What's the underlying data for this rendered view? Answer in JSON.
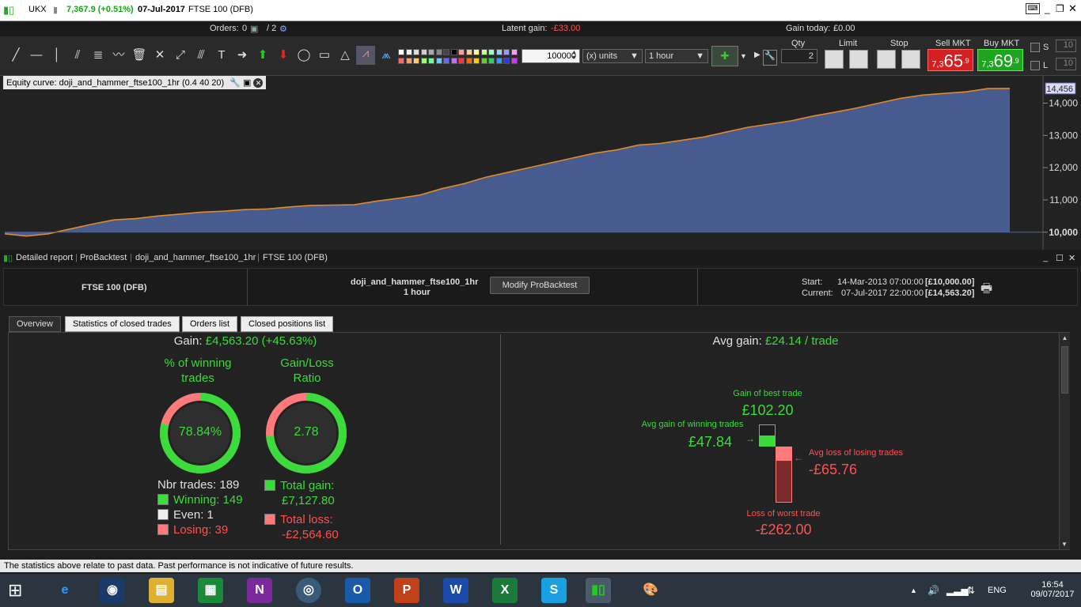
{
  "titlebar": {
    "symbol": "UKX",
    "price": "7,367.9 (+0.51%)",
    "date": "07-Jul-2017",
    "instrument": "FTSE 100 (DFB)"
  },
  "infobar": {
    "orders_label": "Orders:",
    "orders_count": "0",
    "orders_count2": "/ 2",
    "latent_label": "Latent gain:",
    "latent_value": "-£33.00",
    "gain_today_label": "Gain today:",
    "gain_today_value": "£0.00"
  },
  "toolbar": {
    "quantity_value": "100000",
    "units_option": "(x) units",
    "timeframe_option": "1 hour",
    "qty_header": "Qty",
    "qty_value": "2",
    "limit_header": "Limit",
    "stop_header": "Stop",
    "sell_header": "Sell MKT",
    "buy_header": "Buy MKT",
    "sell_prefix": "7,3",
    "sell_big": "65",
    "sell_sup": ".9",
    "buy_prefix": "7,3",
    "buy_big": "69",
    "buy_sup": ".9",
    "s_label": "S",
    "l_label": "L",
    "s_value": "10",
    "l_value": "10"
  },
  "chart": {
    "title": "Equity curve: doji_and_hammer_ftse100_1hr (0.4 40 20)",
    "current_value_label": "14,456",
    "yticks": [
      "14,000",
      "13,000",
      "12,000",
      "11,000",
      "10,000"
    ]
  },
  "chart_data": {
    "type": "area",
    "title": "Equity curve: doji_and_hammer_ftse100_1hr (0.4 40 20)",
    "xlabel": "",
    "ylabel": "",
    "ylim": [
      9700,
      14600
    ],
    "baseline": 10000,
    "series": [
      {
        "values": [
          9950,
          9880,
          9950,
          10100,
          10250,
          10380,
          10420,
          10500,
          10560,
          10620,
          10650,
          10700,
          10720,
          10780,
          10830,
          10840,
          10850,
          10960,
          11050,
          11150,
          11350,
          11500,
          11700,
          11850,
          12000,
          12150,
          12300,
          12450,
          12550,
          12700,
          12750,
          12850,
          12950,
          13100,
          13250,
          13350,
          13450,
          13600,
          13720,
          13850,
          14000,
          14150,
          14250,
          14300,
          14350,
          14450,
          14456
        ]
      }
    ]
  },
  "report": {
    "panel_label": "Detailed report",
    "crumb1": "ProBacktest",
    "crumb2": "doji_and_hammer_ftse100_1hr",
    "crumb3": "FTSE 100 (DFB)",
    "instrument": "FTSE 100 (DFB)",
    "strategy": "doji_and_hammer_ftse100_1hr",
    "timeframe": "1 hour",
    "modify_button": "Modify ProBacktest",
    "start_label": "Start:",
    "start_date": "14-Mar-2013 07:00:00",
    "start_value": "[£10,000.00]",
    "current_label": "Current:",
    "current_date": "07-Jul-2017 22:00:00",
    "current_value": "[£14,563.20]"
  },
  "tabs": [
    "Overview",
    "Statistics of closed trades",
    "Orders list",
    "Closed positions list"
  ],
  "overview": {
    "gain_label": "Gain:",
    "gain_value": "£4,563.20 (+45.63%)",
    "win_title1": "% of winning",
    "win_title2": "trades",
    "win_pct": "78.84%",
    "win_fraction": 0.7884,
    "ratio_title1": "Gain/Loss",
    "ratio_title2": "Ratio",
    "ratio_value": "2.78",
    "ratio_fraction": 0.7355,
    "nbr_trades": "Nbr trades: 189",
    "winning": "Winning: 149",
    "even": "Even: 1",
    "losing": "Losing: 39",
    "total_gain_label": "Total gain:",
    "total_gain_value": "£7,127.80",
    "total_loss_label": "Total loss:",
    "total_loss_value": "-£2,564.60",
    "avg_gain_label": "Avg gain:",
    "avg_gain_value": "£24.14 / trade",
    "best_label": "Gain of best trade",
    "best_value": "£102.20",
    "avg_win_label": "Avg gain of winning trades",
    "avg_win_value": "£47.84",
    "avg_loss_label": "Avg loss of losing trades",
    "avg_loss_value": "-£65.76",
    "worst_label": "Loss of worst trade",
    "worst_value": "-£262.00"
  },
  "disclaimer": "The statistics above relate to past data. Past performance is not indicative of future results.",
  "taskbar": {
    "lang": "ENG",
    "time": "16:54",
    "date": "09/07/2017"
  },
  "colors": {
    "green": "#3adb3a",
    "red": "#ff5050",
    "area_fill": "#4a5f95",
    "curve": "#e08a2a"
  }
}
